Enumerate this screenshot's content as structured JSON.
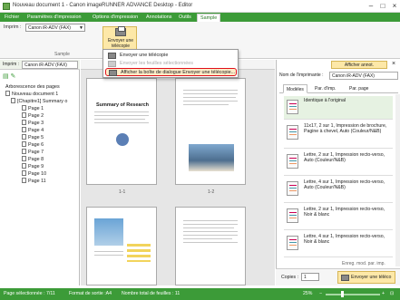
{
  "window": {
    "title": "Nouveau document 1 - Canon imageRUNNER ADVANCE Desktop - Editor"
  },
  "menu": {
    "tabs": [
      {
        "label": "Fichier"
      },
      {
        "label": "Paramètres d'impression"
      },
      {
        "label": "Options d'impression"
      },
      {
        "label": "Annotations"
      },
      {
        "label": "Outils"
      },
      {
        "label": "Sample"
      }
    ],
    "active_index": 5
  },
  "ribbon": {
    "printer_label": "Imprim :",
    "printer_value": "Canon iR-ADV (FAX)",
    "send_button": "Envoyer une télécopie",
    "group_label": "Sample"
  },
  "dropdown": {
    "items": [
      {
        "label": "Envoyer une télécopie"
      },
      {
        "label": "Envoyer les feuilles sélectionnées"
      },
      {
        "label": "Afficher la boîte de dialogue Envoyer une télécopie..."
      }
    ]
  },
  "left": {
    "printer_label": "Imprim :",
    "printer_value": "Canon iR-ADV (FAX)",
    "heading": "Arborescence des pages",
    "document": "Nouveau document 1",
    "chapter": "[Chapitre1] Summary o",
    "pages": [
      "Page 1",
      "Page 2",
      "Page 3",
      "Page 4",
      "Page 5",
      "Page 6",
      "Page 7",
      "Page 8",
      "Page 9",
      "Page 10",
      "Page 11"
    ]
  },
  "center": {
    "pages": [
      {
        "label": "1-1",
        "heading": "Summary of Research"
      },
      {
        "label": "1-2"
      }
    ]
  },
  "right": {
    "show_button": "Afficher annot.",
    "printer_label": "Nom de l'imprimante :",
    "printer_value": "Canon iR-ADV (FAX)",
    "tabs": [
      "Modèles",
      "Par. d'imp.",
      "Par. page"
    ],
    "cards": [
      {
        "text": "Identique à l'original"
      },
      {
        "text": "11x17, 2 sur 1, Impression de brochure, Pagine à chevel, Auto (Couleur/N&B)"
      },
      {
        "text": "Lettre, 2 sur 1, Impression recto-verso, Auto (Couleur/N&B)"
      },
      {
        "text": "Lettre, 4 sur 1, Impression recto-verso, Auto (Couleur/N&B)"
      },
      {
        "text": "Lettre, 2 sur 1, Impression recto-verso, Noir & blanc"
      },
      {
        "text": "Lettre, 4 sur 1, Impression recto-verso, Noir & blanc"
      }
    ],
    "save_hint": "Enreg. mod. par. imp.",
    "copies_label": "Copies :",
    "copies_value": "1",
    "send_button": "Envoyer une téléco"
  },
  "status": {
    "selected": "Page sélectionnée : 7/11",
    "format": "Format de sortie :A4",
    "sheets": "Nombre total de feuilles : 11",
    "zoom": "25%",
    "zoom_fraction": 0.3
  },
  "colors": {
    "accent": "#3c9b38",
    "highlight": "#e0101a"
  }
}
